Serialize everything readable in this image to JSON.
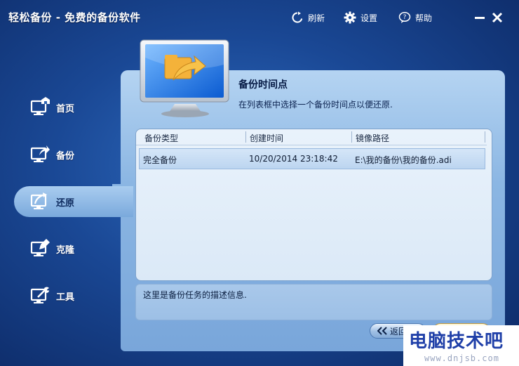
{
  "window": {
    "title": "轻松备份 - 免费的备份软件"
  },
  "toolbar": {
    "refresh_label": "刷新",
    "settings_label": "设置",
    "help_label": "帮助"
  },
  "sidebar": {
    "items": [
      {
        "label": "首页",
        "icon": "home-monitor-icon"
      },
      {
        "label": "备份",
        "icon": "backup-monitor-icon"
      },
      {
        "label": "还原",
        "icon": "restore-monitor-icon",
        "active": true
      },
      {
        "label": "克隆",
        "icon": "clone-monitor-icon"
      },
      {
        "label": "工具",
        "icon": "tools-monitor-icon"
      }
    ]
  },
  "main": {
    "section_title": "备份时间点",
    "section_desc": "在列表框中选择一个备份时间点以便还原.",
    "table": {
      "columns": [
        "备份类型",
        "创建时间",
        "镜像路径"
      ],
      "rows": [
        [
          "完全备份",
          "10/20/2014 23:18:42",
          "E:\\我的备份\\我的备份.adi"
        ]
      ]
    },
    "description_text": "这里是备份任务的描述信息.",
    "back_label": "返回"
  },
  "watermark": {
    "text": "电脑技术吧",
    "url": "www.dnjsb.com"
  },
  "colors": {
    "window_bg": "#1a4895",
    "panel_bg": "#8bb6e3",
    "active_tab": "#a9ccef",
    "selected_row": "#bcd5f0",
    "watermark_text": "#1f3fa8"
  }
}
